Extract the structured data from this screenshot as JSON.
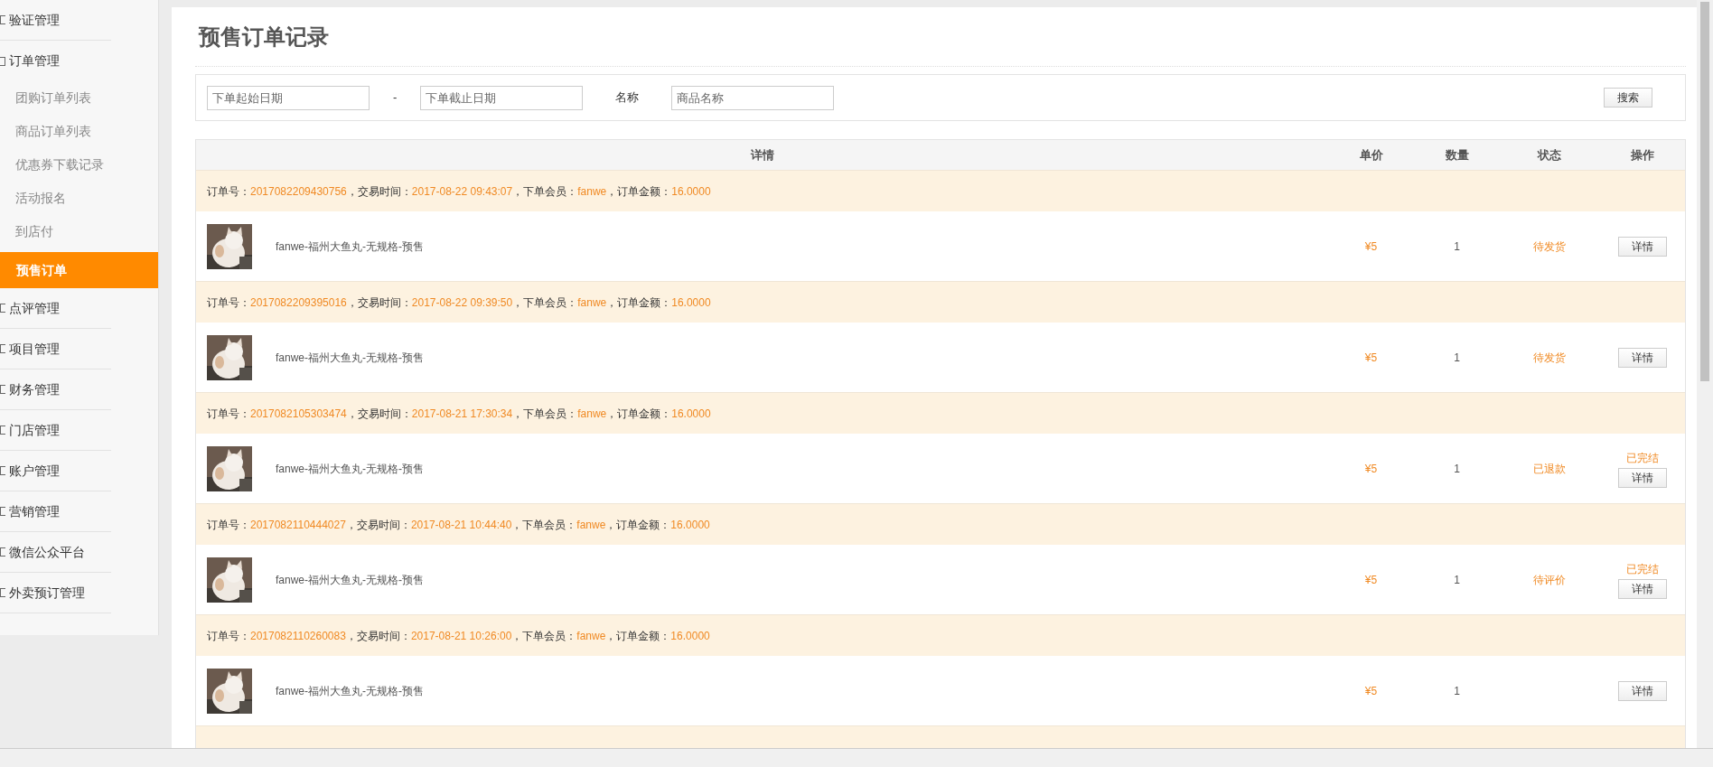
{
  "sidebar": {
    "items": [
      {
        "label": "验证管理",
        "expanded": false
      },
      {
        "label": "订单管理",
        "expanded": true,
        "children": [
          {
            "label": "团购订单列表",
            "selected": false
          },
          {
            "label": "商品订单列表",
            "selected": false
          },
          {
            "label": "优惠券下载记录",
            "selected": false
          },
          {
            "label": "活动报名",
            "selected": false
          },
          {
            "label": "到店付",
            "selected": false
          },
          {
            "label": "预售订单",
            "selected": true
          }
        ]
      },
      {
        "label": "点评管理",
        "expanded": false
      },
      {
        "label": "项目管理",
        "expanded": false
      },
      {
        "label": "财务管理",
        "expanded": false
      },
      {
        "label": "门店管理",
        "expanded": false
      },
      {
        "label": "账户管理",
        "expanded": false
      },
      {
        "label": "营销管理",
        "expanded": false
      },
      {
        "label": "微信公众平台",
        "expanded": false
      },
      {
        "label": "外卖预订管理",
        "expanded": false
      }
    ]
  },
  "page_title": "预售订单记录",
  "filter": {
    "start_date": {
      "placeholder": "下单起始日期"
    },
    "separator": "-",
    "end_date": {
      "placeholder": "下单截止日期"
    },
    "name_label": "名称",
    "name": {
      "placeholder": "商品名称"
    },
    "search_button": "搜索"
  },
  "table": {
    "columns": [
      "详情",
      "单价",
      "数量",
      "状态",
      "操作"
    ],
    "orders": [
      {
        "labels": [
          "订单号：",
          "，交易时间：",
          "，下单会员：",
          "，订单金额："
        ],
        "order_no": "2017082209430756",
        "time": "2017-08-22 09:43:07",
        "member": "fanwe",
        "amount": "16.0000",
        "product": "fanwe-福州大鱼丸-无规格-预售",
        "price": "¥5",
        "qty": "1",
        "status": "待发货",
        "button": "详情"
      },
      {
        "labels": [
          "订单号：",
          "，交易时间：",
          "，下单会员：",
          "，订单金额："
        ],
        "order_no": "2017082209395016",
        "time": "2017-08-22 09:39:50",
        "member": "fanwe",
        "amount": "16.0000",
        "product": "fanwe-福州大鱼丸-无规格-预售",
        "price": "¥5",
        "qty": "1",
        "status": "待发货",
        "button": "详情"
      },
      {
        "labels": [
          "订单号：",
          "，交易时间：",
          "，下单会员：",
          "，订单金额："
        ],
        "order_no": "2017082105303474",
        "time": "2017-08-21 17:30:34",
        "member": "fanwe",
        "amount": "16.0000",
        "product": "fanwe-福州大鱼丸-无规格-预售",
        "price": "¥5",
        "qty": "1",
        "status": "已退款",
        "op_status": "已完结",
        "button": "详情"
      },
      {
        "labels": [
          "订单号：",
          "，交易时间：",
          "，下单会员：",
          "，订单金额："
        ],
        "order_no": "2017082110444027",
        "time": "2017-08-21 10:44:40",
        "member": "fanwe",
        "amount": "16.0000",
        "product": "fanwe-福州大鱼丸-无规格-预售",
        "price": "¥5",
        "qty": "1",
        "status": "待评价",
        "op_status": "已完结",
        "button": "详情"
      },
      {
        "labels": [
          "订单号：",
          "，交易时间：",
          "，下单会员：",
          "，订单金额："
        ],
        "order_no": "2017082110260083",
        "time": "2017-08-21 10:26:00",
        "member": "fanwe",
        "amount": "16.0000",
        "product": "fanwe-福州大鱼丸-无规格-预售",
        "price": "¥5",
        "qty": "1",
        "button": "详情"
      }
    ]
  }
}
